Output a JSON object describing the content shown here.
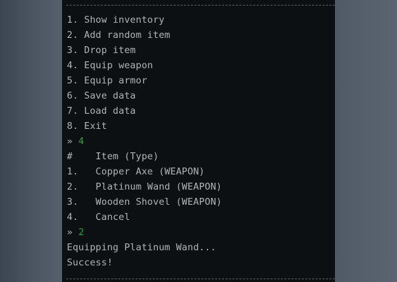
{
  "main_menu": [
    "1. Show inventory",
    "2. Add random item",
    "3. Drop item",
    "4. Equip weapon",
    "5. Equip armor",
    "6. Save data",
    "7. Load data",
    "8. Exit"
  ],
  "prompt_symbol": "»",
  "first_input": "4",
  "item_table": {
    "header": "#    Item (Type)",
    "rows": [
      "1.   Copper Axe (WEAPON)",
      "2.   Platinum Wand (WEAPON)",
      "3.   Wooden Shovel (WEAPON)",
      "4.   Cancel"
    ]
  },
  "second_input": "2",
  "messages": {
    "equipping": "Equipping Platinum Wand...",
    "result": "Success!"
  }
}
